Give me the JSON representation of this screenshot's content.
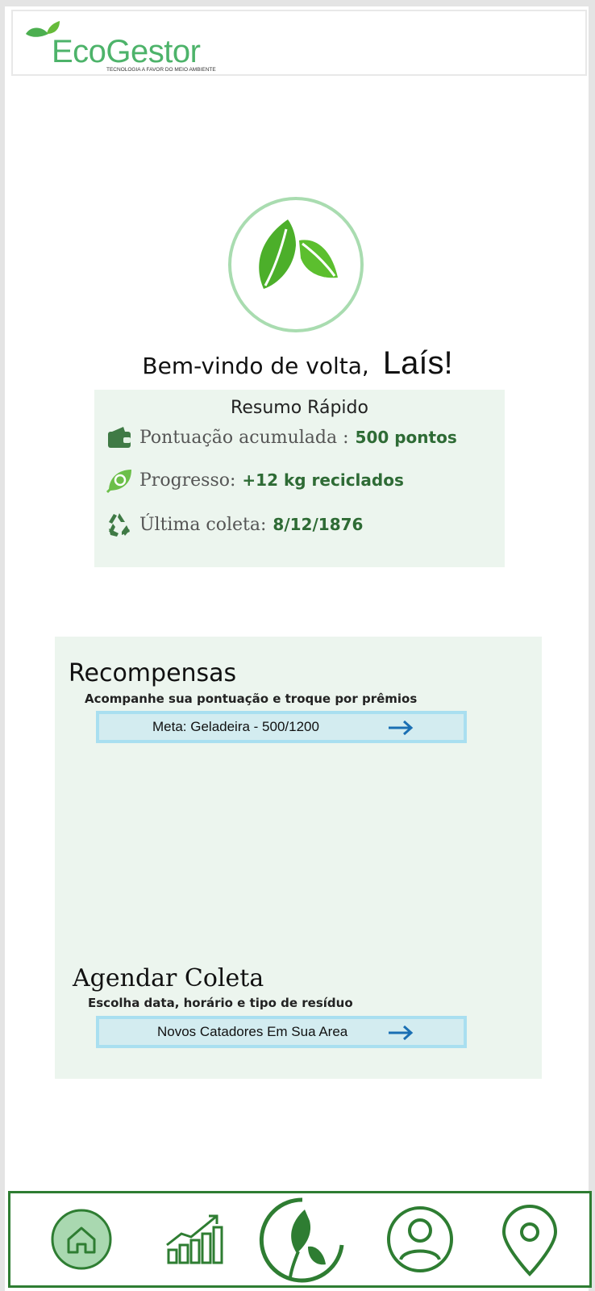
{
  "brand": {
    "name": "EcoGestor",
    "tagline": "TECNOLOGIA A FAVOR DO MEIO AMBIENTE",
    "color": "#4db36a"
  },
  "welcome": {
    "greeting": "Bem-vindo de volta,",
    "user_name": "Laís!"
  },
  "summary": {
    "title": "Resumo Rápido",
    "rows": [
      {
        "icon": "wallet-icon",
        "label": "Pontuação acumulada :",
        "value": "500 pontos"
      },
      {
        "icon": "recycle-leaf-icon",
        "label": "Progresso:",
        "value": "+12 kg reciclados"
      },
      {
        "icon": "recycle-icon",
        "label": "Última coleta:",
        "value": "8/12/1876"
      }
    ]
  },
  "rewards": {
    "title": "Recompensas",
    "subtitle": "Acompanhe sua pontuação e troque por prêmios",
    "button_label": "Meta: Geladeira -  500/1200"
  },
  "collection": {
    "title": "Agendar Coleta",
    "subtitle": "Escolha data, horário e tipo de resíduo",
    "button_label": "Novos Catadores Em Sua Area"
  },
  "nav": {
    "items": [
      {
        "icon": "home-icon",
        "active": true
      },
      {
        "icon": "chart-icon",
        "active": false
      },
      {
        "icon": "leaf-icon",
        "active": false
      },
      {
        "icon": "user-icon",
        "active": false
      },
      {
        "icon": "location-pin-icon",
        "active": false
      }
    ]
  },
  "colors": {
    "accent_dark": "#2e7d32",
    "panel_bg": "#ecf5ee",
    "button_bg": "#d3ecf0",
    "arrow": "#1a6fb3"
  }
}
